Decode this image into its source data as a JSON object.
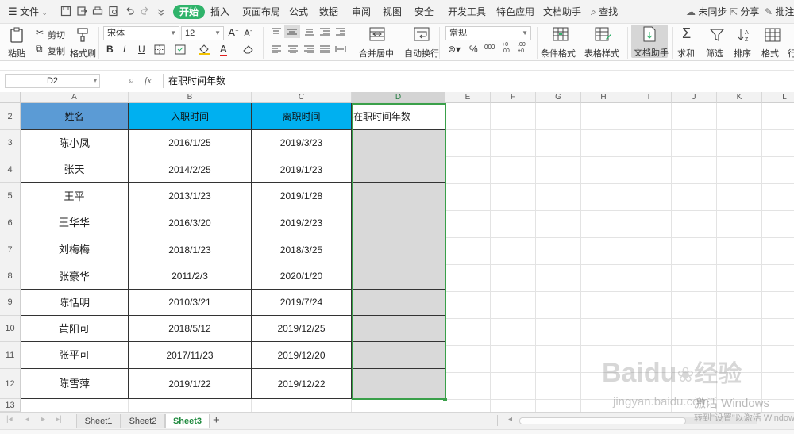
{
  "menu": {
    "file": "文件",
    "tabs": [
      "开始",
      "插入",
      "页面布局",
      "公式",
      "数据",
      "审阅",
      "视图",
      "安全",
      "开发工具",
      "特色应用",
      "文档助手"
    ],
    "find": "查找",
    "sync": "未同步",
    "share": "分享",
    "comment": "批注"
  },
  "ribbon": {
    "paste": "粘贴",
    "cut": "剪切",
    "copy": "复制",
    "format_painter": "格式刷",
    "font_name": "宋体",
    "font_size": "12",
    "number_format": "常规",
    "merge_center": "合并居中",
    "wrap_text": "自动换行",
    "conditional_format": "条件格式",
    "table_style": "表格样式",
    "doc_assistant": "文档助手",
    "sum": "求和",
    "filter": "筛选",
    "sort": "排序",
    "format": "格式",
    "row": "行",
    "bold": "B",
    "italic": "I",
    "underline": "U",
    "font_grow": "A",
    "font_shrink": "A",
    "percent": "%",
    "thousands": "000",
    "inc_decimal": "+0 .00",
    "dec_decimal": ".00 +0"
  },
  "formula_bar": {
    "name_box": "D2",
    "fx": "fx",
    "content": "在职时间年数"
  },
  "columns": [
    "A",
    "B",
    "C",
    "D",
    "E",
    "F",
    "G",
    "H",
    "I",
    "J",
    "K",
    "L"
  ],
  "rows": [
    "2",
    "3",
    "4",
    "5",
    "6",
    "7",
    "8",
    "9",
    "10",
    "11",
    "12",
    "13"
  ],
  "table": {
    "headers": [
      "姓名",
      "入职时间",
      "离职时间",
      "在职时间年数"
    ],
    "rows": [
      [
        "陈小凤",
        "2016/1/25",
        "2019/3/23"
      ],
      [
        "张天",
        "2014/2/25",
        "2019/1/23"
      ],
      [
        "王平",
        "2013/1/23",
        "2019/1/28"
      ],
      [
        "王华华",
        "2016/3/20",
        "2019/2/23"
      ],
      [
        "刘梅梅",
        "2018/1/23",
        "2018/3/25"
      ],
      [
        "张豪华",
        "2011/2/3",
        "2020/1/20"
      ],
      [
        "陈恬明",
        "2010/3/21",
        "2019/7/24"
      ],
      [
        "黄阳可",
        "2018/5/12",
        "2019/12/25"
      ],
      [
        "张平可",
        "2017/11/23",
        "2019/12/20"
      ],
      [
        "陈雪萍",
        "2019/1/22",
        "2019/12/22"
      ]
    ]
  },
  "sheets": [
    "Sheet1",
    "Sheet2",
    "Sheet3"
  ],
  "active_sheet": "Sheet3",
  "watermark": {
    "baidu": "Baidu",
    "jingyan": "经验",
    "url": "jingyan.baidu.com",
    "activate1": "激活 Windows",
    "activate2": "转到\"设置\"以激活 Windows"
  },
  "colors": {
    "accent_green": "#2fb36a",
    "header_name_bg": "#5b9bd5",
    "header_date_bg": "#00b0f0",
    "selected_cells_bg": "#d9d9d9",
    "selection_border": "#3aa04a"
  }
}
